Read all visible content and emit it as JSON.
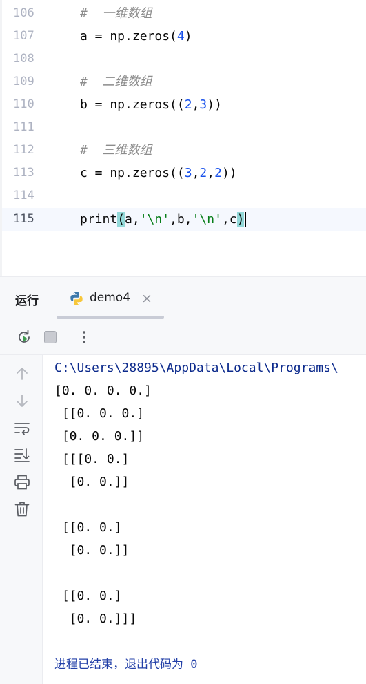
{
  "editor": {
    "lines": [
      {
        "num": "106",
        "code": "#  一维数组"
      },
      {
        "num": "107",
        "code": "a = np.zeros(4)"
      },
      {
        "num": "108",
        "code": ""
      },
      {
        "num": "109",
        "code": "#  二维数组"
      },
      {
        "num": "110",
        "code": "b = np.zeros((2,3))"
      },
      {
        "num": "111",
        "code": ""
      },
      {
        "num": "112",
        "code": "#  三维数组"
      },
      {
        "num": "113",
        "code": "c = np.zeros((3,2,2))"
      },
      {
        "num": "114",
        "code": ""
      },
      {
        "num": "115",
        "code": "print(a,'\\n',b,'\\n',c)"
      }
    ]
  },
  "run_panel": {
    "title": "运行",
    "tab_label": "demo4"
  },
  "toolbar": {
    "rerun_icon": "rerun-icon",
    "stop_icon": "stop-icon",
    "more_icon": "more-vertical-icon"
  },
  "side_toolbar": [
    "arrow-up-icon",
    "arrow-down-icon",
    "soft-wrap-icon",
    "scroll-to-end-icon",
    "print-icon",
    "trash-icon"
  ],
  "console": {
    "lines": [
      "C:\\Users\\28895\\AppData\\Local\\Programs\\",
      "[0. 0. 0. 0.]",
      " [[0. 0. 0.]",
      " [0. 0. 0.]]",
      " [[[0. 0.]",
      "  [0. 0.]]",
      "",
      " [[0. 0.]",
      "  [0. 0.]]",
      "",
      " [[0. 0.]",
      "  [0. 0.]]]",
      "",
      "进程已结束，退出代码为 0"
    ]
  },
  "colors": {
    "keyword_number": "#1750eb",
    "string": "#067d17",
    "comment": "#8c8c8c",
    "bracket_highlight": "#93d9d9",
    "path_text": "#0c2a8c"
  }
}
